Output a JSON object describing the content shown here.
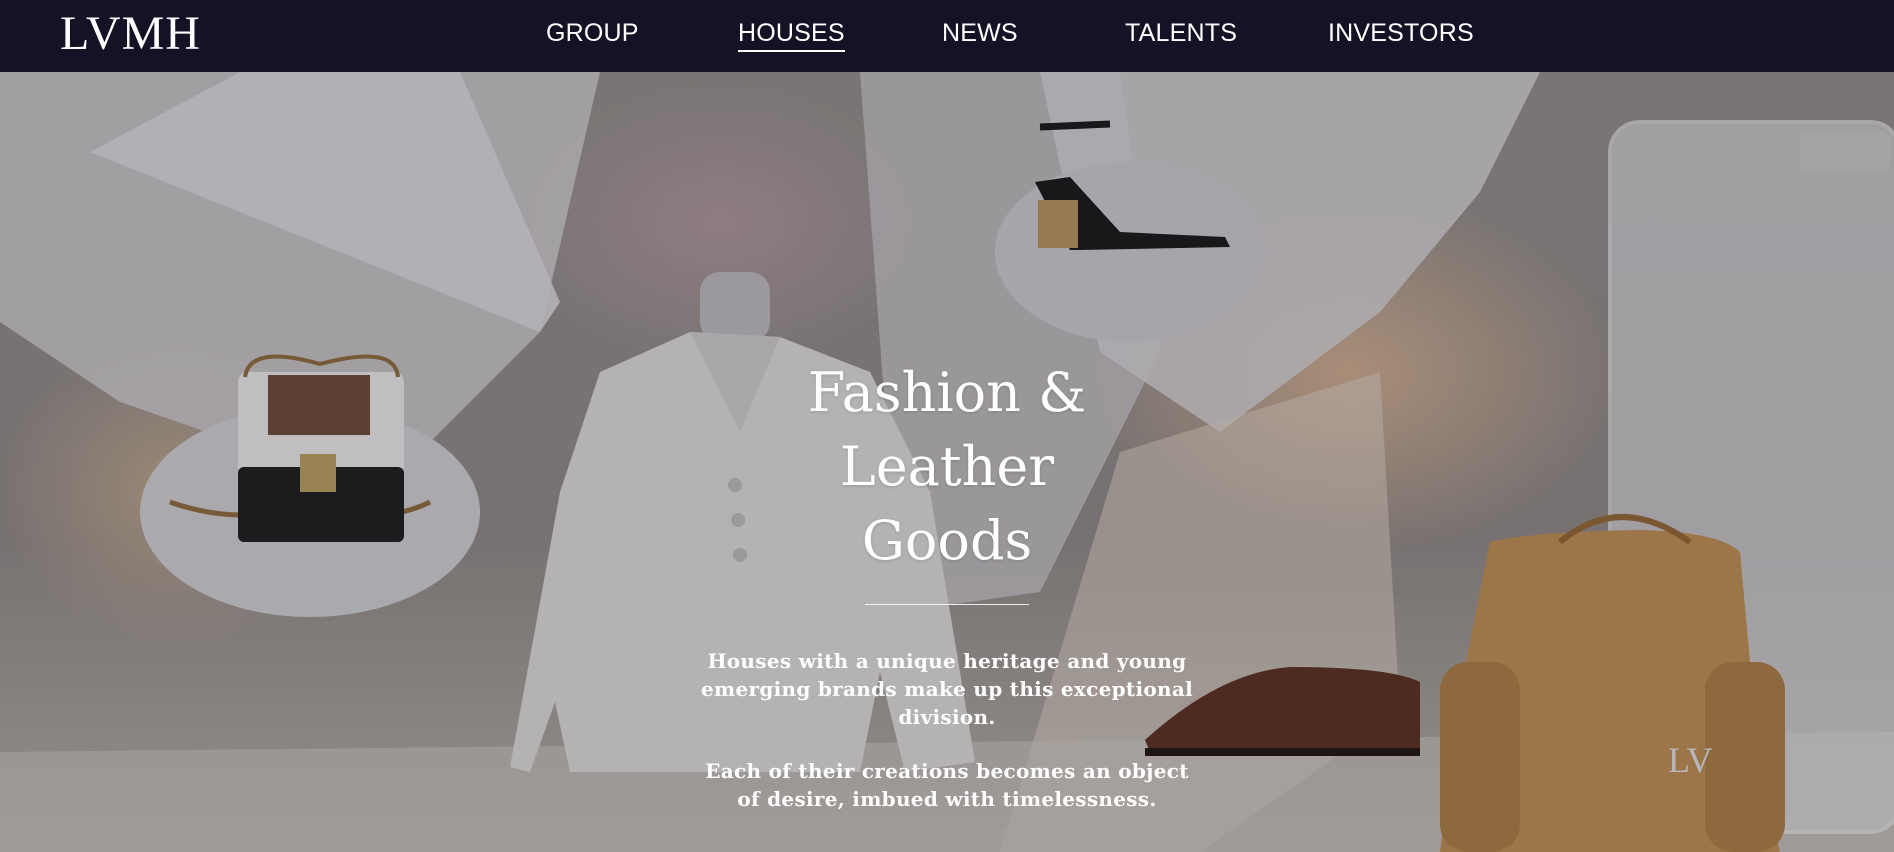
{
  "header": {
    "logo": "LVMH",
    "nav": [
      {
        "label": "GROUP",
        "active": false
      },
      {
        "label": "HOUSES",
        "active": true
      },
      {
        "label": "NEWS",
        "active": false
      },
      {
        "label": "TALENTS",
        "active": false
      },
      {
        "label": "INVESTORS",
        "active": false
      }
    ]
  },
  "hero": {
    "title_line1": "Fashion & Leather",
    "title_line2": "Goods",
    "paragraph1": "Houses with a unique heritage and young emerging brands make up this exceptional division.",
    "paragraph2": "Each of their creations becomes an object of desire, imbued with timelessness."
  },
  "colors": {
    "header_bg": "#131325",
    "text": "#ffffff"
  }
}
